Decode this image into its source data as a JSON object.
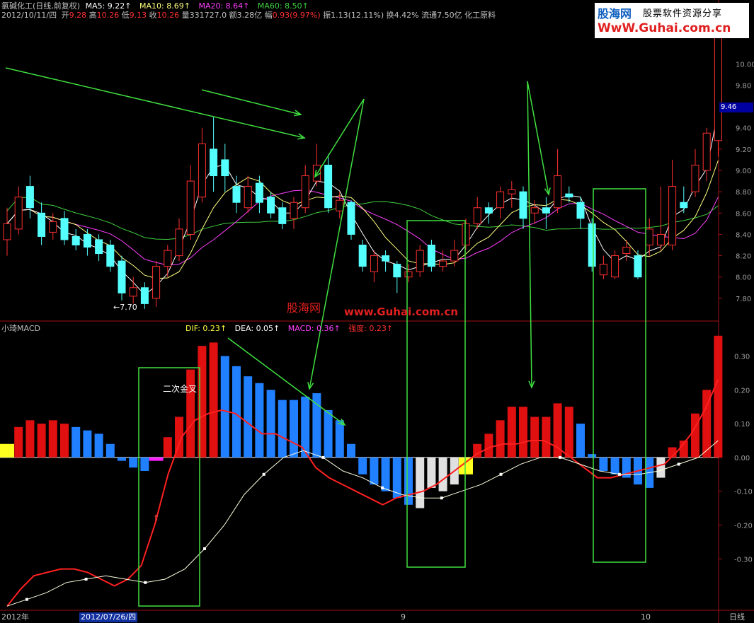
{
  "header": {
    "stock_name": "氯碱化工(日线,前复权)",
    "ma5_label": "MA5: 9.22↑",
    "ma10_label": "MA10: 8.69↑",
    "ma20_label": "MA20: 8.64↑",
    "ma60_label": "MA60: 8.50↑",
    "date": "2012/10/11/四",
    "open_label": "开",
    "open": "9.28",
    "high_label": "高",
    "high": "10.26",
    "low_label": "低",
    "low": "9.13",
    "close_label": "收",
    "close": "10.26",
    "volume": "量331727.0",
    "amount": "额3.28亿",
    "change_label": "幅",
    "change": "0.93(9.97%)",
    "amplitude": "振1.13(12.11%)",
    "turnover": "换4.42%",
    "float_cap": "流通7.50亿",
    "sector": "化工原料"
  },
  "logo": {
    "brand": "股海网",
    "slogan": "股票软件资源分享",
    "url": "WwW.Guhai.com.cn"
  },
  "watermark": {
    "brand": "股海网",
    "url": "www.Guhai.com.cn"
  },
  "indicator": {
    "name": "小琦MACD",
    "dif": "DIF: 0.23↑",
    "dea": "DEA: 0.05↑",
    "macd": "MACD: 0.36↑",
    "strength": "强度: 0.23↑"
  },
  "annotation": {
    "golden_cross": "二次金叉",
    "low_marker": "←7.70"
  },
  "current_price": "9.46",
  "xaxis": {
    "year": "2012年",
    "cursor_date": "2012/07/26/四",
    "month9": "9",
    "month10": "10",
    "period": "日线"
  },
  "colors": {
    "up": "#ff3030",
    "down": "#54ffff",
    "ma5": "#ffffff",
    "ma10": "#ffff80",
    "ma20": "#ff40ff",
    "ma60": "#40d040",
    "dif": "#ff2020",
    "dea": "#ffffe0",
    "arrow": "#40e040"
  },
  "chart_data": [
    {
      "type": "candlestick",
      "title": "氯碱化工(日线,前复权)",
      "y_ticks": [
        7.8,
        8.0,
        8.2,
        8.4,
        8.6,
        8.8,
        9.0,
        9.2,
        9.4,
        9.6,
        9.8,
        10.0
      ],
      "ylim": [
        7.6,
        10.4
      ],
      "grid": false,
      "candles": [
        {
          "o": 8.35,
          "c": 8.5,
          "h": 8.65,
          "l": 8.2
        },
        {
          "o": 8.45,
          "c": 8.75,
          "h": 8.85,
          "l": 8.4
        },
        {
          "o": 8.85,
          "c": 8.65,
          "h": 8.95,
          "l": 8.55
        },
        {
          "o": 8.6,
          "c": 8.38,
          "h": 8.7,
          "l": 8.3
        },
        {
          "o": 8.42,
          "c": 8.52,
          "h": 8.6,
          "l": 8.35
        },
        {
          "o": 8.55,
          "c": 8.35,
          "h": 8.62,
          "l": 8.3
        },
        {
          "o": 8.38,
          "c": 8.3,
          "h": 8.45,
          "l": 8.25
        },
        {
          "o": 8.4,
          "c": 8.28,
          "h": 8.45,
          "l": 8.2
        },
        {
          "o": 8.35,
          "c": 8.22,
          "h": 8.4,
          "l": 8.15
        },
        {
          "o": 8.3,
          "c": 8.1,
          "h": 8.35,
          "l": 8.05
        },
        {
          "o": 8.15,
          "c": 7.85,
          "h": 8.2,
          "l": 7.78
        },
        {
          "o": 7.82,
          "c": 7.9,
          "h": 8.0,
          "l": 7.75
        },
        {
          "o": 7.9,
          "c": 7.75,
          "h": 7.95,
          "l": 7.7
        },
        {
          "o": 7.8,
          "c": 8.1,
          "h": 8.15,
          "l": 7.72
        },
        {
          "o": 8.1,
          "c": 8.25,
          "h": 8.3,
          "l": 8.0
        },
        {
          "o": 8.2,
          "c": 8.45,
          "h": 8.55,
          "l": 8.15
        },
        {
          "o": 8.4,
          "c": 8.9,
          "h": 9.05,
          "l": 8.35
        },
        {
          "o": 8.75,
          "c": 9.25,
          "h": 9.4,
          "l": 8.7
        },
        {
          "o": 9.2,
          "c": 8.95,
          "h": 9.5,
          "l": 8.8
        },
        {
          "o": 9.1,
          "c": 8.95,
          "h": 9.25,
          "l": 8.8
        },
        {
          "o": 8.85,
          "c": 8.7,
          "h": 8.95,
          "l": 8.6
        },
        {
          "o": 8.65,
          "c": 8.85,
          "h": 8.95,
          "l": 8.6
        },
        {
          "o": 8.88,
          "c": 8.7,
          "h": 8.95,
          "l": 8.6
        },
        {
          "o": 8.75,
          "c": 8.6,
          "h": 8.8,
          "l": 8.55
        },
        {
          "o": 8.65,
          "c": 8.5,
          "h": 8.7,
          "l": 8.45
        },
        {
          "o": 8.55,
          "c": 8.7,
          "h": 8.75,
          "l": 8.45
        },
        {
          "o": 8.65,
          "c": 8.95,
          "h": 9.05,
          "l": 8.6
        },
        {
          "o": 8.9,
          "c": 9.05,
          "h": 9.25,
          "l": 8.85
        },
        {
          "o": 9.05,
          "c": 8.65,
          "h": 9.15,
          "l": 8.6
        },
        {
          "o": 8.62,
          "c": 8.72,
          "h": 8.8,
          "l": 8.55
        },
        {
          "o": 8.7,
          "c": 8.4,
          "h": 8.72,
          "l": 8.35
        },
        {
          "o": 8.3,
          "c": 8.1,
          "h": 8.35,
          "l": 8.05
        },
        {
          "o": 8.05,
          "c": 8.2,
          "h": 8.25,
          "l": 7.95
        },
        {
          "o": 8.2,
          "c": 8.15,
          "h": 8.25,
          "l": 8.05
        },
        {
          "o": 8.12,
          "c": 8.0,
          "h": 8.15,
          "l": 7.85
        },
        {
          "o": 8.0,
          "c": 8.05,
          "h": 8.12,
          "l": 7.95
        },
        {
          "o": 8.05,
          "c": 8.25,
          "h": 8.3,
          "l": 8.0
        },
        {
          "o": 8.3,
          "c": 8.1,
          "h": 8.35,
          "l": 8.05
        },
        {
          "o": 8.1,
          "c": 8.15,
          "h": 8.25,
          "l": 8.05
        },
        {
          "o": 8.15,
          "c": 8.25,
          "h": 8.35,
          "l": 8.1
        },
        {
          "o": 8.3,
          "c": 8.5,
          "h": 8.55,
          "l": 8.25
        },
        {
          "o": 8.5,
          "c": 8.65,
          "h": 8.75,
          "l": 8.45
        },
        {
          "o": 8.65,
          "c": 8.6,
          "h": 8.7,
          "l": 8.5
        },
        {
          "o": 8.65,
          "c": 8.8,
          "h": 8.85,
          "l": 8.55
        },
        {
          "o": 8.78,
          "c": 8.82,
          "h": 8.9,
          "l": 8.65
        },
        {
          "o": 8.8,
          "c": 8.55,
          "h": 8.85,
          "l": 8.45
        },
        {
          "o": 8.6,
          "c": 8.65,
          "h": 8.72,
          "l": 8.5
        },
        {
          "o": 8.65,
          "c": 8.6,
          "h": 8.75,
          "l": 8.45
        },
        {
          "o": 8.65,
          "c": 8.95,
          "h": 9.2,
          "l": 8.6
        },
        {
          "o": 8.78,
          "c": 8.75,
          "h": 8.85,
          "l": 8.7
        },
        {
          "o": 8.7,
          "c": 8.55,
          "h": 8.75,
          "l": 8.45
        },
        {
          "o": 8.5,
          "c": 8.1,
          "h": 8.55,
          "l": 8.05
        },
        {
          "o": 8.02,
          "c": 8.12,
          "h": 8.2,
          "l": 7.98
        },
        {
          "o": 8.0,
          "c": 8.2,
          "h": 8.25,
          "l": 7.98
        },
        {
          "o": 8.22,
          "c": 8.28,
          "h": 8.35,
          "l": 8.15
        },
        {
          "o": 8.2,
          "c": 8.0,
          "h": 8.25,
          "l": 7.98
        },
        {
          "o": 8.3,
          "c": 8.45,
          "h": 8.55,
          "l": 8.2
        },
        {
          "o": 8.3,
          "c": 8.4,
          "h": 8.85,
          "l": 8.25
        },
        {
          "o": 8.3,
          "c": 8.85,
          "h": 9.1,
          "l": 8.25
        },
        {
          "o": 8.7,
          "c": 8.65,
          "h": 8.85,
          "l": 8.6
        },
        {
          "o": 8.8,
          "c": 9.05,
          "h": 9.2,
          "l": 8.75
        },
        {
          "o": 9.0,
          "c": 9.35,
          "h": 9.4,
          "l": 8.9
        },
        {
          "o": 9.28,
          "c": 10.26,
          "h": 10.26,
          "l": 9.13
        }
      ]
    },
    {
      "type": "bar",
      "title": "小琦MACD",
      "y_ticks": [
        -0.3,
        -0.2,
        -0.1,
        0.0,
        0.1,
        0.2,
        0.3
      ],
      "ylim": [
        -0.45,
        0.37
      ],
      "grid": false,
      "macd": [
        0.04,
        0.09,
        0.11,
        0.1,
        0.11,
        0.1,
        0.09,
        0.08,
        0.07,
        0.04,
        -0.01,
        -0.03,
        -0.04,
        -0.01,
        0.06,
        0.12,
        0.26,
        0.33,
        0.34,
        0.3,
        0.27,
        0.24,
        0.22,
        0.2,
        0.17,
        0.17,
        0.18,
        0.19,
        0.14,
        0.11,
        0.04,
        -0.05,
        -0.08,
        -0.1,
        -0.12,
        -0.14,
        -0.15,
        -0.09,
        -0.1,
        -0.08,
        -0.05,
        0.04,
        0.07,
        0.11,
        0.15,
        0.15,
        0.12,
        0.12,
        0.16,
        0.15,
        0.1,
        0.01,
        -0.04,
        -0.05,
        -0.06,
        -0.08,
        -0.09,
        -0.06,
        0.03,
        0.05,
        0.13,
        0.2,
        0.36
      ],
      "macd_styles": [
        "y",
        "r",
        "r",
        "r",
        "r",
        "r",
        "b",
        "b",
        "b",
        "b",
        "b",
        "b",
        "b",
        "m",
        "r",
        "r",
        "r",
        "r",
        "r",
        "b",
        "b",
        "b",
        "b",
        "b",
        "b",
        "b",
        "b",
        "b",
        "b",
        "b",
        "b",
        "b",
        "b",
        "b",
        "b",
        "b",
        "w",
        "w",
        "w",
        "w",
        "y",
        "r",
        "r",
        "r",
        "r",
        "r",
        "r",
        "r",
        "r",
        "r",
        "b",
        "b",
        "b",
        "b",
        "b",
        "b",
        "b",
        "w",
        "r",
        "r",
        "r",
        "r",
        "r"
      ],
      "dif": [
        -0.44,
        -0.39,
        -0.35,
        -0.34,
        -0.33,
        -0.33,
        -0.34,
        -0.36,
        -0.38,
        -0.36,
        -0.32,
        -0.2,
        -0.05,
        0.06,
        0.11,
        0.13,
        0.14,
        0.13,
        0.1,
        0.07,
        0.07,
        0.05,
        0.03,
        -0.03,
        -0.06,
        -0.08,
        -0.1,
        -0.12,
        -0.14,
        -0.12,
        -0.11,
        -0.1,
        -0.08,
        -0.05,
        -0.02,
        0.01,
        0.03,
        0.04,
        0.04,
        0.05,
        0.05,
        0.03,
        0.0,
        -0.03,
        -0.06,
        -0.06,
        -0.05,
        -0.04,
        -0.03,
        -0.02,
        0.02,
        0.07,
        0.14,
        0.23
      ],
      "dea": [
        -0.44,
        -0.42,
        -0.4,
        -0.37,
        -0.36,
        -0.35,
        -0.36,
        -0.37,
        -0.36,
        -0.33,
        -0.27,
        -0.2,
        -0.11,
        -0.05,
        0.0,
        0.02,
        0.0,
        -0.04,
        -0.06,
        -0.09,
        -0.11,
        -0.12,
        -0.12,
        -0.1,
        -0.08,
        -0.05,
        -0.02,
        0.0,
        0.0,
        -0.02,
        -0.04,
        -0.05,
        -0.05,
        -0.04,
        -0.02,
        0.0,
        0.05
      ],
      "cross_marker": 13
    }
  ]
}
